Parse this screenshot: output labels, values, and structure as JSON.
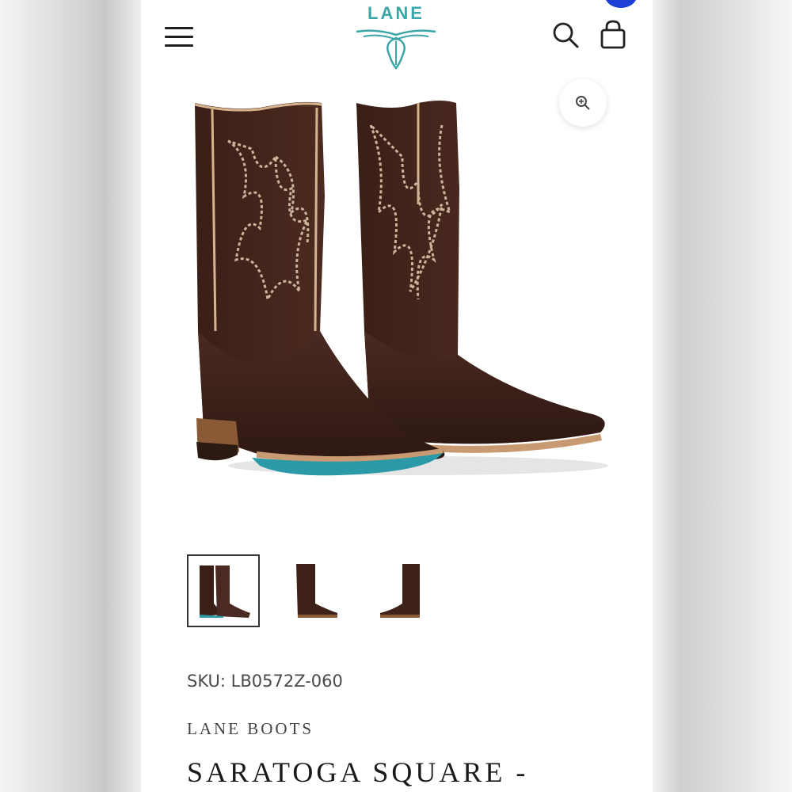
{
  "header": {
    "logo_text": "LANE",
    "menu_icon": "hamburger-menu-icon",
    "search_icon": "search-icon",
    "cart_icon": "shopping-bag-icon",
    "accent_color": "#3aa6a8"
  },
  "gallery": {
    "zoom_icon": "zoom-in-icon",
    "thumbnails": [
      {
        "view": "pair"
      },
      {
        "view": "side"
      },
      {
        "view": "back"
      }
    ],
    "active_index": 0
  },
  "product": {
    "sku": "SKU: LB0572Z-060",
    "brand": "LANE BOOTS",
    "title": "SARATOGA SQUARE -"
  }
}
